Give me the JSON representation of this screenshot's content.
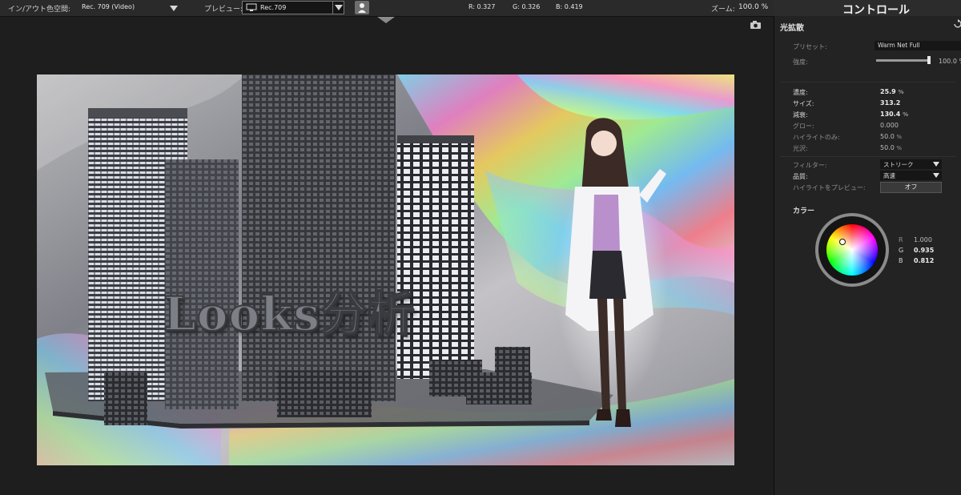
{
  "toolbar": {
    "inout_label": "イン/アウト色空間:",
    "inout_value": "Rec. 709 (Video)",
    "preview_label": "プレビュー:",
    "preview_value": "Rec.709",
    "r_readout": "R: 0.327",
    "g_readout": "G: 0.326",
    "b_readout": "B: 0.419",
    "zoom_label": "ズーム:",
    "zoom_value": "100.0 %"
  },
  "viewer": {
    "overlay_text": "Looks分析"
  },
  "panel": {
    "title": "コントロール",
    "section": "光拡散",
    "preset_label": "プリセット:",
    "preset_value": "Warm Net Full",
    "strength_label": "強度:",
    "strength_value": "100.0 %",
    "strength_level": 1.0,
    "params": [
      {
        "label": "濃度:",
        "value": "25.9",
        "unit": "%"
      },
      {
        "label": "サイズ:",
        "value": "313.2",
        "unit": ""
      },
      {
        "label": "減衰:",
        "value": "130.4",
        "unit": "%"
      },
      {
        "label": "グロー:",
        "value": "0.000",
        "unit": ""
      },
      {
        "label": "ハイライトのみ:",
        "value": "50.0",
        "unit": "%"
      },
      {
        "label": "光沢:",
        "value": "50.0",
        "unit": "%"
      }
    ],
    "filter_label": "フィルター:",
    "filter_value": "ストリーク",
    "quality_label": "品質:",
    "quality_value": "高速",
    "highlight_preview_label": "ハイライトをプレビュー:",
    "highlight_preview_button": "オフ",
    "color_label": "カラー",
    "color_r_label": "R",
    "color_r": "1.000",
    "color_g_label": "G",
    "color_g": "0.935",
    "color_b_label": "B",
    "color_b": "0.812",
    "reset_icon": "reset-icon"
  }
}
